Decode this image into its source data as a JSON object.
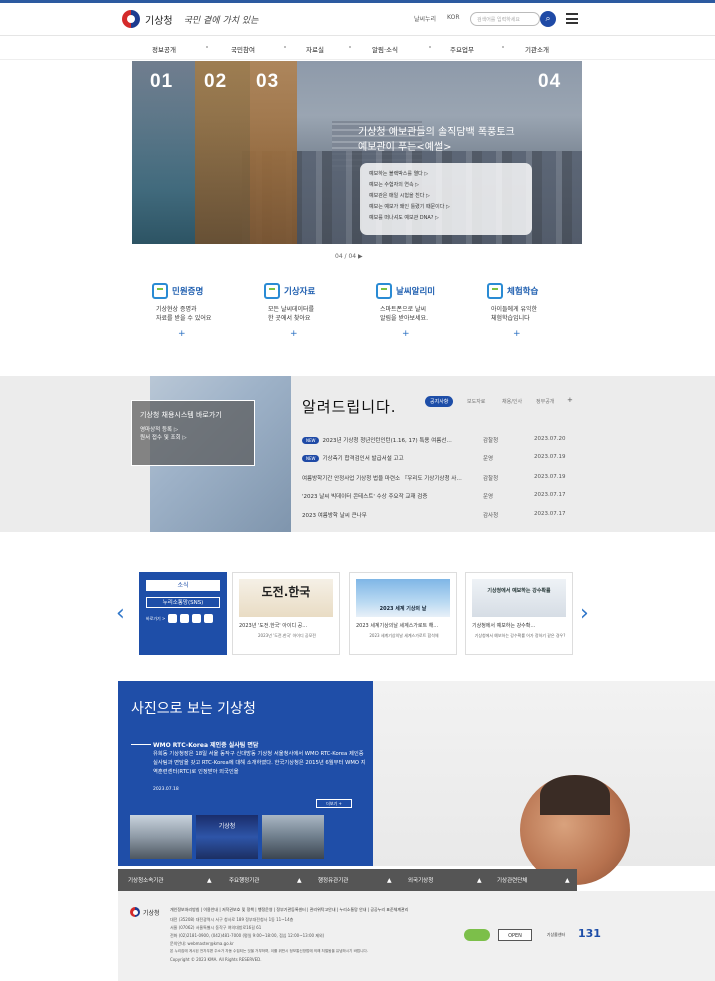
{
  "header": {
    "logo_text": "기상청",
    "slogan": "국민 곁에 가치 있는",
    "util_links": [
      "날씨누리",
      "KOR"
    ],
    "search_placeholder": "검색어를 입력하세요",
    "search_icon": "search-icon",
    "menu_icon": "menu-icon"
  },
  "gnb": [
    "정보공개",
    "국민참여",
    "자료실",
    "알림·소식",
    "주요업무",
    "기관소개"
  ],
  "hero": {
    "panel_numbers": [
      "01",
      "02",
      "03",
      "04"
    ],
    "title_line1": "기상청 예보관들의 솔직담백 폭풍토크",
    "title_line2": "예보관이 푸는<예썰>",
    "list": [
      "예보하는 블랙박스를 열다 ▷",
      "예보는 수험자의 연속 ▷",
      "예보관은 매일 시험을 친다 ▷",
      "예보는 예보가 왜인 틀렸기 때문이다 ▷",
      "예보를 떠나셔도 예보관 DNA? ▷"
    ],
    "pager": "04 / 04 ▶"
  },
  "quick_links": [
    {
      "icon": "document-certificate-icon",
      "title": "민원증명",
      "desc1": "기상현상 증명과",
      "desc2": "자료를 받을 수 있어요"
    },
    {
      "icon": "weather-data-icon",
      "title": "기상자료",
      "desc1": "모든 날씨데이터를",
      "desc2": "한 곳에서 찾아요"
    },
    {
      "icon": "weather-alert-icon",
      "title": "날씨알리미",
      "desc1": "스마트폰으로 날씨",
      "desc2": "알림을 받아보세요."
    },
    {
      "icon": "experience-icon",
      "title": "체험학습",
      "desc1": "아이들에게 유익한",
      "desc2": "체험학습입니다"
    }
  ],
  "quick_plus": "+",
  "notice": {
    "box_title": "기상청 채용시스템 바로가기",
    "box_links": [
      "영마상적 등록 ▷",
      "원서 접수 및 조회 ▷"
    ],
    "title": "알려드립니다.",
    "tabs": [
      "공지사항",
      "보도자료",
      "채용/인사",
      "정부공개"
    ],
    "more": "+",
    "rows": [
      {
        "badge": "NEW",
        "title": "2023년 기상청 청년인턴인턴(1.16, 17) 특용 여름선…",
        "dept": "감찰청",
        "date": "2023.07.20"
      },
      {
        "badge": "NEW",
        "title": "기상측기 합격검인서 발급서설 고고",
        "dept": "운영",
        "date": "2023.07.19"
      },
      {
        "badge": "",
        "title": "여름방학기간 안정사업 기상청 법을 마련소 『우리도 기상기상청 사…",
        "dept": "감찰청",
        "date": "2023.07.19"
      },
      {
        "badge": "",
        "title": "'2023 날씨 빅데이터 콘테스트' 수상 주요작 교재 검증",
        "dept": "운영",
        "date": "2023.07.17"
      },
      {
        "badge": "",
        "title": "2023 여름방학 날씨 큰나무",
        "dept": "감사청",
        "date": "2023.07.17"
      }
    ]
  },
  "news": {
    "prev_icon": "‹",
    "next_icon": "›",
    "sns_head": "소식",
    "sns_button": "누리소통망(SNS)",
    "sns_label": "바로가기 >",
    "cards": [
      {
        "img_text": "도전.한국",
        "title": "2023년 '도전.한국' 아이디 공…",
        "sub": "2023년 '도전.한국' 아이디 공모전"
      },
      {
        "img_text": "2023 세계 기상의 날",
        "title": "2023 세계기상의날 세계스가로트 해…",
        "sub": "2023 세계기상의날 세계스가로트 합석체"
      },
      {
        "img_text": "기상청에서 예보하는 강수확률",
        "title": "기상청에서 예보하는 강수확…",
        "sub": "기상청에서 예보하는 강수확률 어가 정하기 같은 경우?"
      }
    ]
  },
  "photo": {
    "title": "사진으로 보는 기상청",
    "headline": "WMO RTC-Korea 제인증 실사팀 면담",
    "body": "유희동 기상청장은 18일 서울 동작구 신대방동 기상청 서울청사에서 WMO RTC-Korea 제인증 실사팀과 면담을 갖고 RTC-Korea에 대해 소개하였다. 한국기상청은 2015년 6월부터 WMO 지역훈련센터(RTC)로 인정받아 외국인을",
    "date": "2023.07.18",
    "more": "더보기 +",
    "thumb2_text": "기상청"
  },
  "footer": {
    "selects": [
      "기상청소속기관",
      "주요행정기관",
      "행정유관기관",
      "외국기상청",
      "기상관련단체"
    ],
    "logo_text": "기상청",
    "links": "개인정보처리방침 | 이용안내 | 저작권보호 및 정책 | 행정운영 | 정부기관등록센터 | 관리위탁고안내 | 누리소통망 안내 | 공공누리 표준체계관리",
    "address1": "대전 (35208) 대전광역시 서구 청사로 189 정부대전청사 1동 11~14층",
    "address2": "서울 (07062) 서울특별시 동작구 여의대방로16길 61",
    "phone": "전화 (02)2181-0900, (042)481-7000 (평일 9:00~18:00, 점심 12:00~13:00 제외)",
    "email": "문의안내: webmaster@kma.go.kr",
    "notice": "본 누리집에 게시된 전자우편 주소가 자동 수집되는 것을 거부하며, 이를 위반시 정보통신망법에 의해 처벌됨을 유념하시기 바랍니다.",
    "copyright": "Copyright © 2023 KMA. All Rights RESERVED.",
    "badge_open": "OPEN",
    "badge_weather": "기상콜센터",
    "call": "131"
  }
}
